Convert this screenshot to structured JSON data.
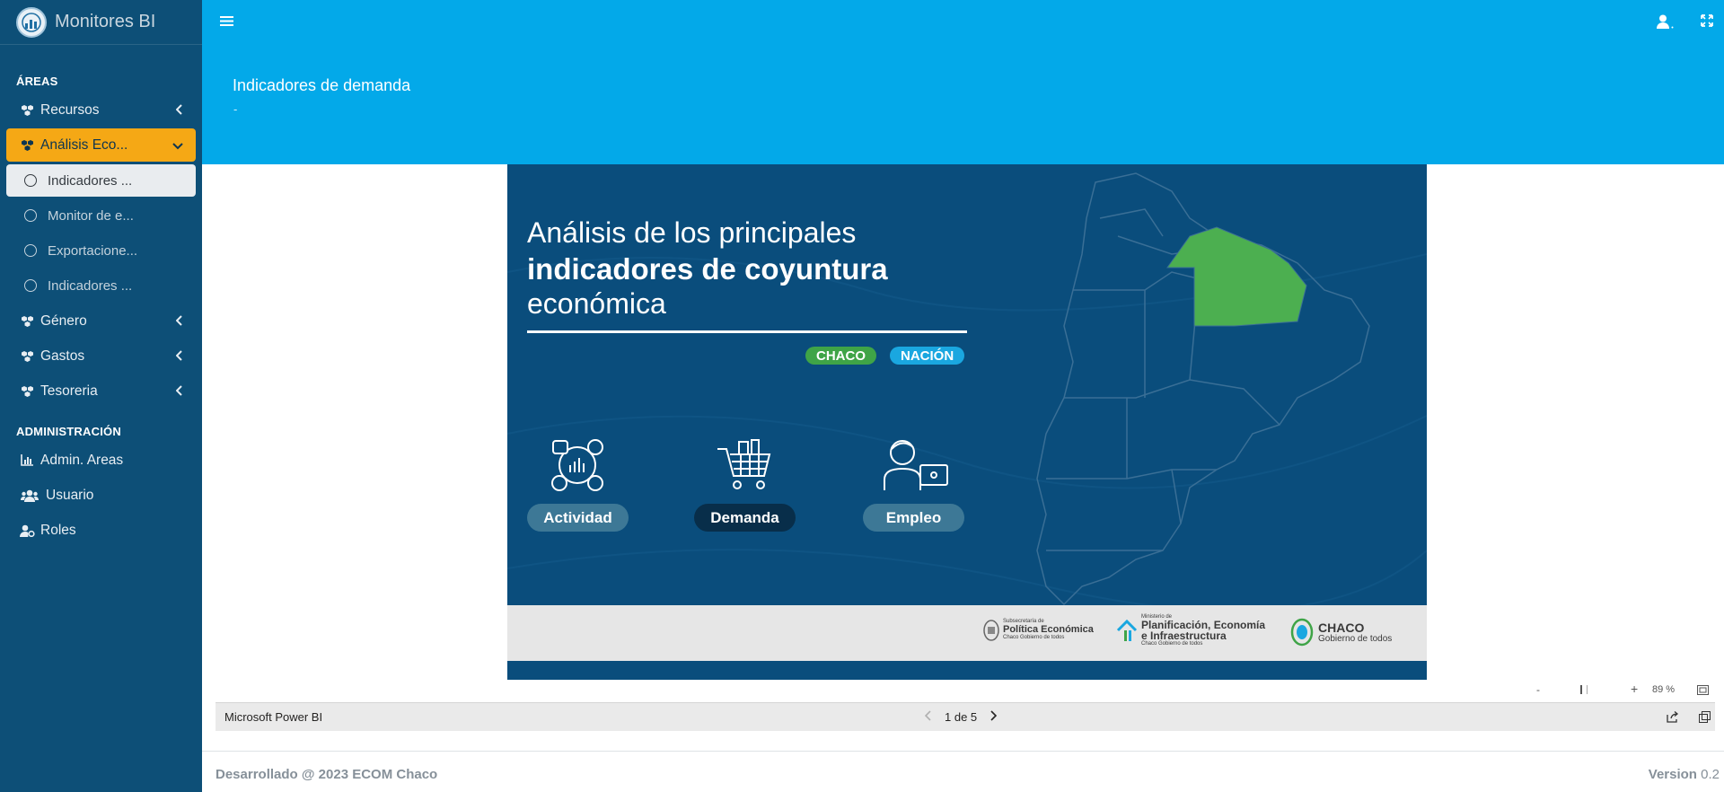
{
  "brand": {
    "title": "Monitores BI"
  },
  "sidebar": {
    "section_areas": "ÁREAS",
    "items": [
      {
        "label": "Recursos"
      },
      {
        "label": "Análisis Eco..."
      },
      {
        "label": "Género"
      },
      {
        "label": "Gastos"
      },
      {
        "label": "Tesoreria"
      }
    ],
    "subitems": [
      {
        "label": "Indicadores ..."
      },
      {
        "label": "Monitor de e..."
      },
      {
        "label": "Exportacione..."
      },
      {
        "label": "Indicadores ..."
      }
    ],
    "section_admin": "ADMINISTRACIÓN",
    "admin_items": [
      {
        "label": "Admin. Areas"
      },
      {
        "label": "Usuario"
      },
      {
        "label": "Roles"
      }
    ]
  },
  "header": {
    "title": "Indicadores de demanda",
    "subtitle": "-"
  },
  "report": {
    "headline_line1": "Análisis de los principales",
    "headline_line2": "indicadores de coyuntura",
    "headline_line3": "económica",
    "tag_chaco": "CHACO",
    "tag_nacion": "NACIÓN",
    "categories": [
      "Actividad",
      "Demanda",
      "Empleo"
    ],
    "logos": {
      "logo1_small": "Subsecretaría de",
      "logo1_big": "Política Económica",
      "logo1_sub": "Chaco Gobierno de todos",
      "logo2_small": "Ministerio de",
      "logo2_big1": "Planificación, Economía",
      "logo2_big2": "e Infraestructura",
      "logo2_sub": "Chaco Gobierno de todos",
      "logo3_big": "CHACO",
      "logo3_sub": "Gobierno de todos"
    }
  },
  "zoom": {
    "minus": "-",
    "plus": "+",
    "level": "89 %"
  },
  "pbi": {
    "name": "Microsoft Power BI",
    "page": "1 de 5"
  },
  "footer": {
    "developed": "Desarrollado @ 2023 ECOM Chaco",
    "version_label": "Version",
    "version_value": "0.2"
  },
  "colors": {
    "sidebar": "#0d4f77",
    "topbar": "#03a9e9",
    "active": "#f5a815",
    "report_bg": "#0a4d7c",
    "map_highlight": "#4caf50"
  }
}
